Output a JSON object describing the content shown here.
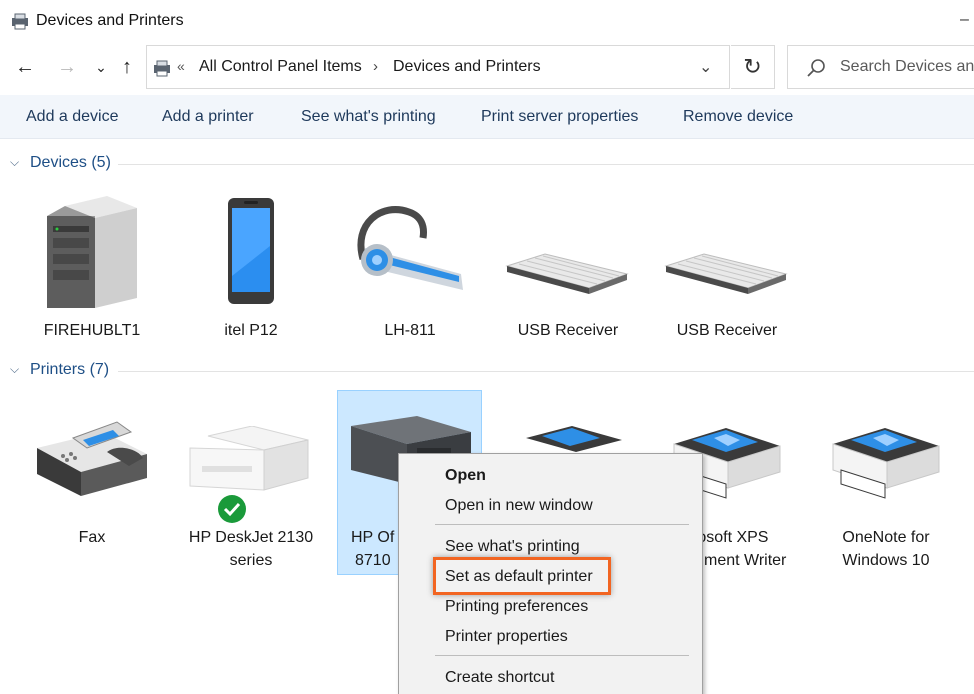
{
  "window": {
    "title": "Devices and Printers",
    "minimize_glyph": "–"
  },
  "nav": {
    "back_glyph": "←",
    "forward_glyph": "→",
    "recent_glyph": "⌄",
    "up_glyph": "↑",
    "overflow_glyph": "«",
    "breadcrumbs": [
      "All Control Panel Items",
      "Devices and Printers"
    ],
    "separator_glyph": "›",
    "dropdown_glyph": "⌄",
    "refresh_glyph": "↻",
    "search_placeholder": "Search Devices and Printers"
  },
  "commands": [
    "Add a device",
    "Add a printer",
    "See what's printing",
    "Print server properties",
    "Remove device"
  ],
  "groups": {
    "devices": {
      "chevron": "⌵",
      "label": "Devices (5)"
    },
    "printers": {
      "chevron": "⌵",
      "label": "Printers (7)"
    }
  },
  "devices": [
    {
      "label": "FIREHUBLT1",
      "icon": "computer-tower-icon"
    },
    {
      "label": "itel P12",
      "icon": "smartphone-icon"
    },
    {
      "label": "LH-811",
      "icon": "bluetooth-headset-icon"
    },
    {
      "label": "USB Receiver",
      "icon": "keyboard-icon"
    },
    {
      "label": "USB Receiver",
      "icon": "keyboard-icon"
    }
  ],
  "printers": [
    {
      "line1": "Fax",
      "line2": "",
      "icon": "fax-machine-icon"
    },
    {
      "line1": "HP DeskJet 2130",
      "line2": "series",
      "icon": "inkjet-printer-icon",
      "default": true
    },
    {
      "line1": "HP Of",
      "line2": "8710",
      "icon": "office-printer-icon",
      "selected": true
    },
    {
      "line1": "",
      "line2": "",
      "icon": "virtual-printer-icon"
    },
    {
      "line1": "rosoft XPS",
      "line2": "ment Writer",
      "icon": "virtual-printer-icon"
    },
    {
      "line1": "OneNote for",
      "line2": "Windows 10",
      "icon": "virtual-printer-icon"
    }
  ],
  "context_menu": {
    "items": [
      {
        "label": "Open",
        "bold": true
      },
      {
        "label": "Open in new window"
      },
      {
        "label": "See what's printing"
      },
      {
        "label": "Set as default printer",
        "highlighted": true
      },
      {
        "label": "Printing preferences"
      },
      {
        "label": "Printer properties"
      },
      {
        "label": "Create shortcut"
      }
    ]
  },
  "colors": {
    "accent_link": "#1e395b",
    "group_header": "#1e4f86",
    "selection": "#cce8ff",
    "highlight_box": "#f26522",
    "default_badge": "#1a9a3a"
  }
}
